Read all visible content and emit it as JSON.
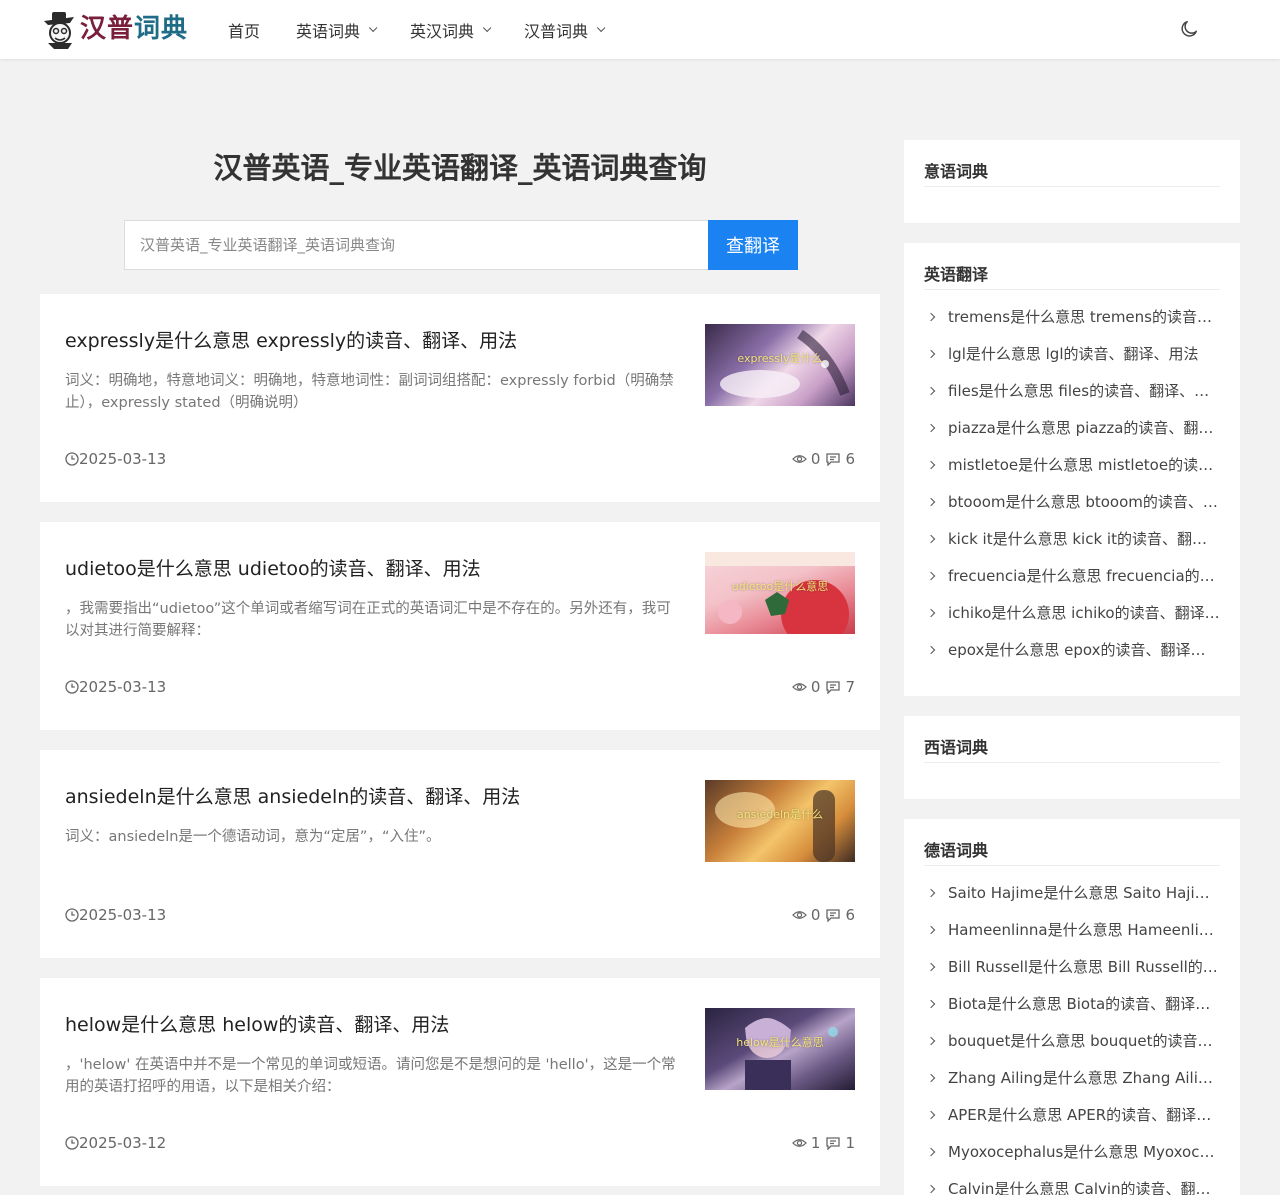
{
  "header": {
    "logo_text_1": "汉普",
    "logo_text_2": "词典",
    "nav": [
      {
        "label": "首页",
        "dropdown": false
      },
      {
        "label": "英语词典",
        "dropdown": true
      },
      {
        "label": "英汉词典",
        "dropdown": true
      },
      {
        "label": "汉普词典",
        "dropdown": true
      }
    ],
    "theme_icon": "moon-icon"
  },
  "main": {
    "title": "汉普英语_专业英语翻译_英语词典查询",
    "search": {
      "placeholder": "汉普英语_专业英语翻译_英语词典查询",
      "button_label": "查翻译"
    },
    "posts": [
      {
        "title": "expressly是什么意思 expressly的读音、翻译、用法",
        "excerpt": "词义：明确地，特意地词义：明确地，特意地词性：副词词组搭配：expressly forbid（明确禁止），expressly stated（明确说明）",
        "date": "2025-03-13",
        "views": "0",
        "comments": "6",
        "thumb_caption": "expressly是什么"
      },
      {
        "title": "udietoo是什么意思 udietoo的读音、翻译、用法",
        "excerpt": "，我需要指出“udietoo”这个单词或者缩写词在正式的英语词汇中是不存在的。另外还有，我可以对其进行简要解释：",
        "date": "2025-03-13",
        "views": "0",
        "comments": "7",
        "thumb_caption": "udietoo是什么意思"
      },
      {
        "title": "ansiedeln是什么意思 ansiedeln的读音、翻译、用法",
        "excerpt": "词义：ansiedeln是一个德语动词，意为“定居”，“入住”。",
        "date": "2025-03-13",
        "views": "0",
        "comments": "6",
        "thumb_caption": "ansiedeln是什么"
      },
      {
        "title": "helow是什么意思 helow的读音、翻译、用法",
        "excerpt": "，'helow' 在英语中并不是一个常见的单词或短语。请问您是不是想问的是 'hello'，这是一个常用的英语打招呼的用语，以下是相关介绍：",
        "date": "2025-03-12",
        "views": "1",
        "comments": "1",
        "thumb_caption": "helow是什么意思"
      }
    ]
  },
  "sidebar": {
    "widgets": [
      {
        "title": "意语词典",
        "items": []
      },
      {
        "title": "英语翻译",
        "items": [
          "tremens是什么意思 tremens的读音、翻译、用法",
          "lgl是什么意思 lgl的读音、翻译、用法",
          "files是什么意思 files的读音、翻译、用法",
          "piazza是什么意思 piazza的读音、翻译、用法",
          "mistletoe是什么意思 mistletoe的读音、翻译、用法",
          "btooom是什么意思 btooom的读音、翻译、用法",
          "kick it是什么意思 kick it的读音、翻译、用法",
          "frecuencia是什么意思 frecuencia的读音、翻译、用法",
          "ichiko是什么意思 ichiko的读音、翻译、用法",
          "epox是什么意思 epox的读音、翻译、用法"
        ]
      },
      {
        "title": "西语词典",
        "items": []
      },
      {
        "title": "德语词典",
        "items": [
          "Saito Hajime是什么意思 Saito Hajime的读音、翻译、用法",
          "Hameenlinna是什么意思 Hameenlinna的读音、翻译、用法",
          "Bill Russell是什么意思 Bill Russell的读音、翻译、用法",
          "Biota是什么意思 Biota的读音、翻译、用法",
          "bouquet是什么意思 bouquet的读音、翻译、用法",
          "Zhang Ailing是什么意思 Zhang Ailing的读音、翻译、用法",
          "APER是什么意思 APER的读音、翻译、用法",
          "Myoxocephalus是什么意思 Myoxocephalus的读音、翻译、用法",
          "Calvin是什么意思 Calvin的读音、翻译、用法"
        ]
      }
    ]
  },
  "colors": {
    "accent": "#1b82f1",
    "logo_red": "#7a1f3b",
    "logo_teal": "#1f6c86",
    "page_bg": "#f2f2f2"
  }
}
